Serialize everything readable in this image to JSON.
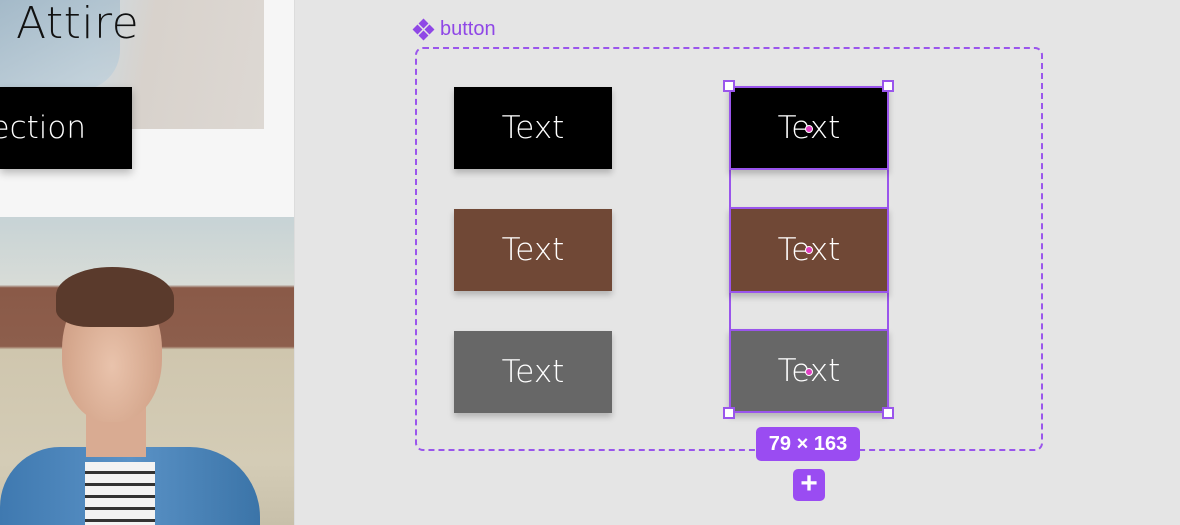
{
  "canvas": {
    "left_preview": {
      "hero_title": "Attire",
      "collection_button_label": "ection"
    },
    "component": {
      "icon": "component-icon",
      "name": "button",
      "accent_color": "#9a4cf2"
    },
    "variants_left": [
      {
        "label": "Text",
        "color": "#000000"
      },
      {
        "label": "Text",
        "color": "#704836"
      },
      {
        "label": "Text",
        "color": "#676767"
      }
    ],
    "variants_selected": [
      {
        "label": "Text",
        "color": "#000000"
      },
      {
        "label": "Text",
        "color": "#704836"
      },
      {
        "label": "Text",
        "color": "#676767"
      }
    ],
    "selection_size": "79 × 163",
    "add_variant_icon": "plus-icon",
    "add_variant_label": "+"
  }
}
